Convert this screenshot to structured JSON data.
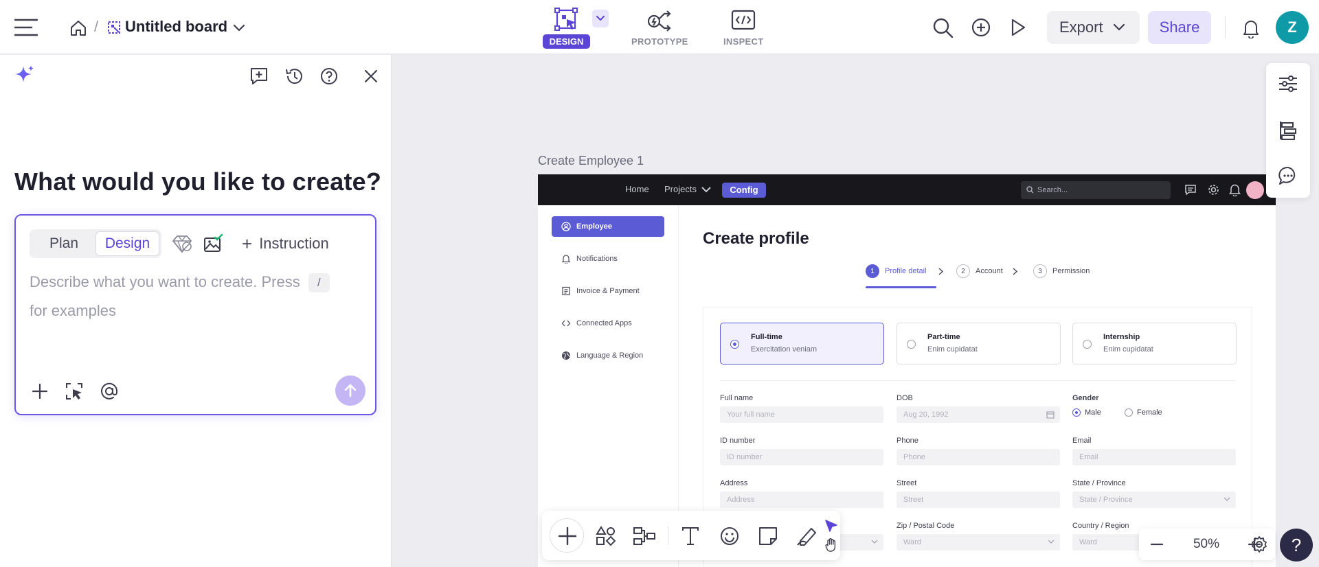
{
  "topbar": {
    "board_title": "Untitled board",
    "tabs": [
      {
        "label": "DESIGN",
        "active": true
      },
      {
        "label": "PROTOTYPE",
        "active": false
      },
      {
        "label": "INSPECT",
        "active": false
      }
    ],
    "export_label": "Export",
    "share_label": "Share",
    "avatar_initial": "Z"
  },
  "ai_panel": {
    "heading": "What would you like to create?",
    "modes": [
      "Plan",
      "Design"
    ],
    "active_mode": "Design",
    "instruction_label": "Instruction",
    "placeholder_part1": "Describe what you want to create. Press",
    "placeholder_key": "/",
    "placeholder_part2": "for examples"
  },
  "canvas": {
    "frame_label": "Create Employee 1",
    "zoom_level": "50%"
  },
  "artboard": {
    "nav": {
      "links": [
        "Home",
        "Projects"
      ],
      "active": "Config",
      "search_placeholder": "Search..."
    },
    "sidebar": [
      {
        "label": "Employee",
        "icon": "user-circle-icon",
        "active": true
      },
      {
        "label": "Notifications",
        "icon": "bell-icon",
        "active": false
      },
      {
        "label": "Invoice & Payment",
        "icon": "invoice-icon",
        "active": false
      },
      {
        "label": "Connected Apps",
        "icon": "code-icon",
        "active": false
      },
      {
        "label": "Language & Region",
        "icon": "globe-icon",
        "active": false
      }
    ],
    "title": "Create profile",
    "steps": [
      {
        "num": "1",
        "label": "Profile detail",
        "active": true
      },
      {
        "num": "2",
        "label": "Account",
        "active": false
      },
      {
        "num": "3",
        "label": "Permission",
        "active": false
      }
    ],
    "employment_types": [
      {
        "title": "Full-time",
        "desc": "Exercitation veniam",
        "selected": true
      },
      {
        "title": "Part-time",
        "desc": "Enim cupidatat",
        "selected": false
      },
      {
        "title": "Internship",
        "desc": "Enim cupidatat",
        "selected": false
      }
    ],
    "fields": {
      "full_name": {
        "label": "Full name",
        "placeholder": "Your full name"
      },
      "dob": {
        "label": "DOB",
        "placeholder": "Aug 20, 1992"
      },
      "gender": {
        "label": "Gender",
        "options": [
          "Male",
          "Female"
        ],
        "selected": "Male"
      },
      "id_number": {
        "label": "ID number",
        "placeholder": "ID number"
      },
      "phone": {
        "label": "Phone",
        "placeholder": "Phone"
      },
      "email": {
        "label": "Email",
        "placeholder": "Email"
      },
      "address": {
        "label": "Address",
        "placeholder": "Address"
      },
      "street": {
        "label": "Street",
        "placeholder": "Street"
      },
      "state": {
        "label": "State / Province",
        "placeholder": "State / Province"
      },
      "zip": {
        "label": "Zip / Postal Code",
        "placeholder": "Ward"
      },
      "country": {
        "label": "Country / Region",
        "placeholder": "Ward"
      }
    }
  },
  "colors": {
    "accent": "#5b45d6",
    "artboard_accent": "#5b5bd6",
    "avatar": "#0e9ba7",
    "canvas_bg": "#ececf1"
  }
}
